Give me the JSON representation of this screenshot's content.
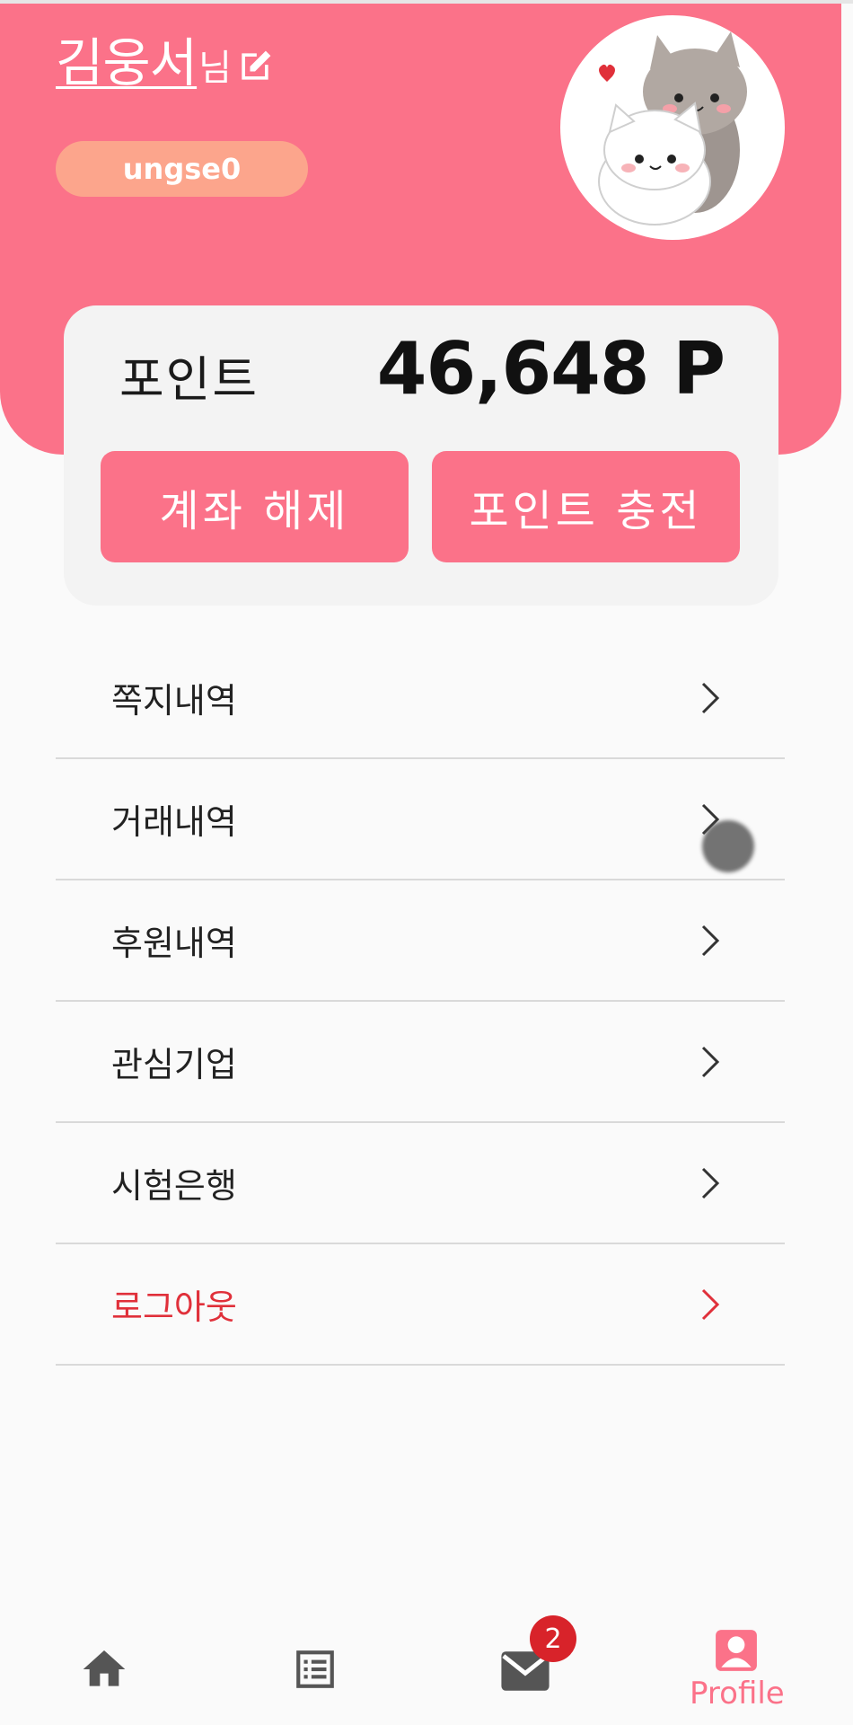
{
  "profile": {
    "name": "김웅서",
    "name_suffix": "님",
    "user_id": "ungse0"
  },
  "points": {
    "label": "포인트",
    "value": "46,648 P",
    "unlink_button": "계좌 해제",
    "charge_button": "포인트 충전"
  },
  "menu": {
    "items": [
      {
        "label": "쪽지내역"
      },
      {
        "label": "거래내역"
      },
      {
        "label": "후원내역"
      },
      {
        "label": "관심기업"
      },
      {
        "label": "시험은행"
      },
      {
        "label": "로그아웃"
      }
    ]
  },
  "bottom_nav": {
    "mail_badge": "2",
    "profile_label": "Profile",
    "icons": [
      "home-icon",
      "list-icon",
      "mail-icon",
      "profile-icon"
    ]
  },
  "colors": {
    "primary": "#fb7289",
    "id_pill": "#fca58c",
    "logout": "#e0303a",
    "badge": "#d8232a"
  }
}
